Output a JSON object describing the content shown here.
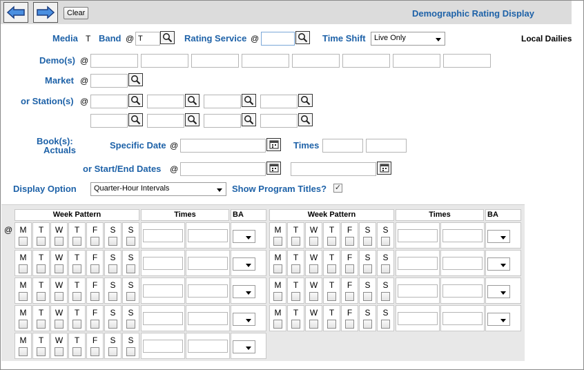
{
  "toolbar": {
    "clear_label": "Clear",
    "title": "Demographic Rating Display"
  },
  "form": {
    "media_label": "Media",
    "media_value": "T",
    "band_label": "Band",
    "at": "@",
    "band_value": "T",
    "rating_service_label": "Rating Service",
    "rating_service_value": "",
    "time_shift_label": "Time Shift",
    "time_shift_value": "Live Only",
    "local_dailies": "Local Dailies",
    "demos_label": "Demo(s)",
    "market_label": "Market",
    "stations_label": "or Station(s)",
    "books_label": "Book(s):",
    "actuals_label": "Actuals",
    "specific_date_label": "Specific Date",
    "times_label": "Times",
    "start_end_label": "or Start/End Dates",
    "display_option_label": "Display Option",
    "display_option_value": "Quarter-Hour Intervals",
    "show_titles_label": "Show Program Titles?",
    "show_titles_checked": "✓"
  },
  "grid": {
    "week_pattern": "Week Pattern",
    "times": "Times",
    "ba": "BA",
    "at": "@",
    "days": [
      "M",
      "T",
      "W",
      "T",
      "F",
      "S",
      "S"
    ]
  },
  "colors": {
    "label": "#1e62a8",
    "toolbar": "#dcdcdc",
    "panel": "#e8e8e8"
  },
  "icons": [
    "back-arrow-icon",
    "forward-arrow-icon",
    "magnifier-icon",
    "calendar-icon",
    "dropdown-arrow-icon",
    "checkmark-icon"
  ]
}
